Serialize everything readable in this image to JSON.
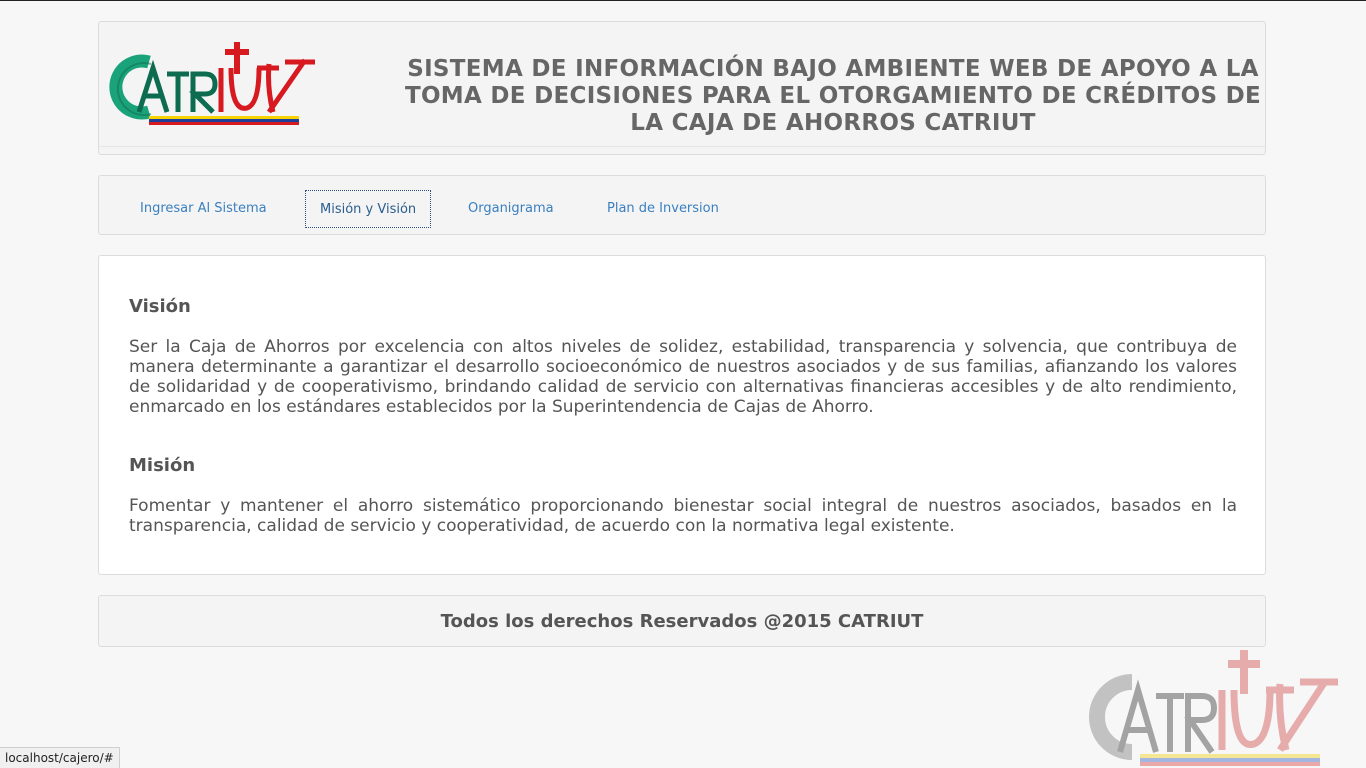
{
  "header": {
    "logo_text": "CATRIUT",
    "title": "SISTEMA DE INFORMACIÓN BAJO AMBIENTE WEB DE APOYO A LA TOMA DE DECISIONES PARA EL OTORGAMIENTO DE CRÉDITOS DE LA CAJA DE AHORROS CATRIUT"
  },
  "nav": {
    "items": [
      {
        "label": "Ingresar Al Sistema"
      },
      {
        "label": "Misión y Visión"
      },
      {
        "label": "Organigrama"
      },
      {
        "label": "Plan de Inversion"
      }
    ],
    "active_index": 1
  },
  "content": {
    "vision_title": "Visión",
    "vision_text": "Ser la Caja de Ahorros por excelencia con altos niveles de solidez, estabilidad, transparencia y solvencia, que contribuya de manera determinante a garantizar el desarrollo socioeconómico de nuestros asociados y de sus familias, afianzando los valores de solidaridad y de cooperativismo, brindando calidad de servicio con alternativas financieras accesibles y de alto rendimiento, enmarcado en los estándares establecidos por la Superintendencia de Cajas de Ahorro.",
    "mision_title": "Misión",
    "mision_text": "Fomentar y mantener el ahorro sistemático proporcionando bienestar social integral de nuestros asociados, basados en la transparencia, calidad de servicio y cooperatividad, de acuerdo con la normativa legal existente."
  },
  "footer": {
    "text": "Todos los derechos Reservados @2015 CATRIUT"
  },
  "statusbar": {
    "url": "localhost/cajero/#"
  },
  "colors": {
    "logo_green": "#1aa37a",
    "logo_red": "#d71920",
    "title_gray": "#666666",
    "link_blue": "#3a7fc0",
    "flag_yellow": "#f5d200",
    "flag_blue": "#1b3f9b"
  }
}
